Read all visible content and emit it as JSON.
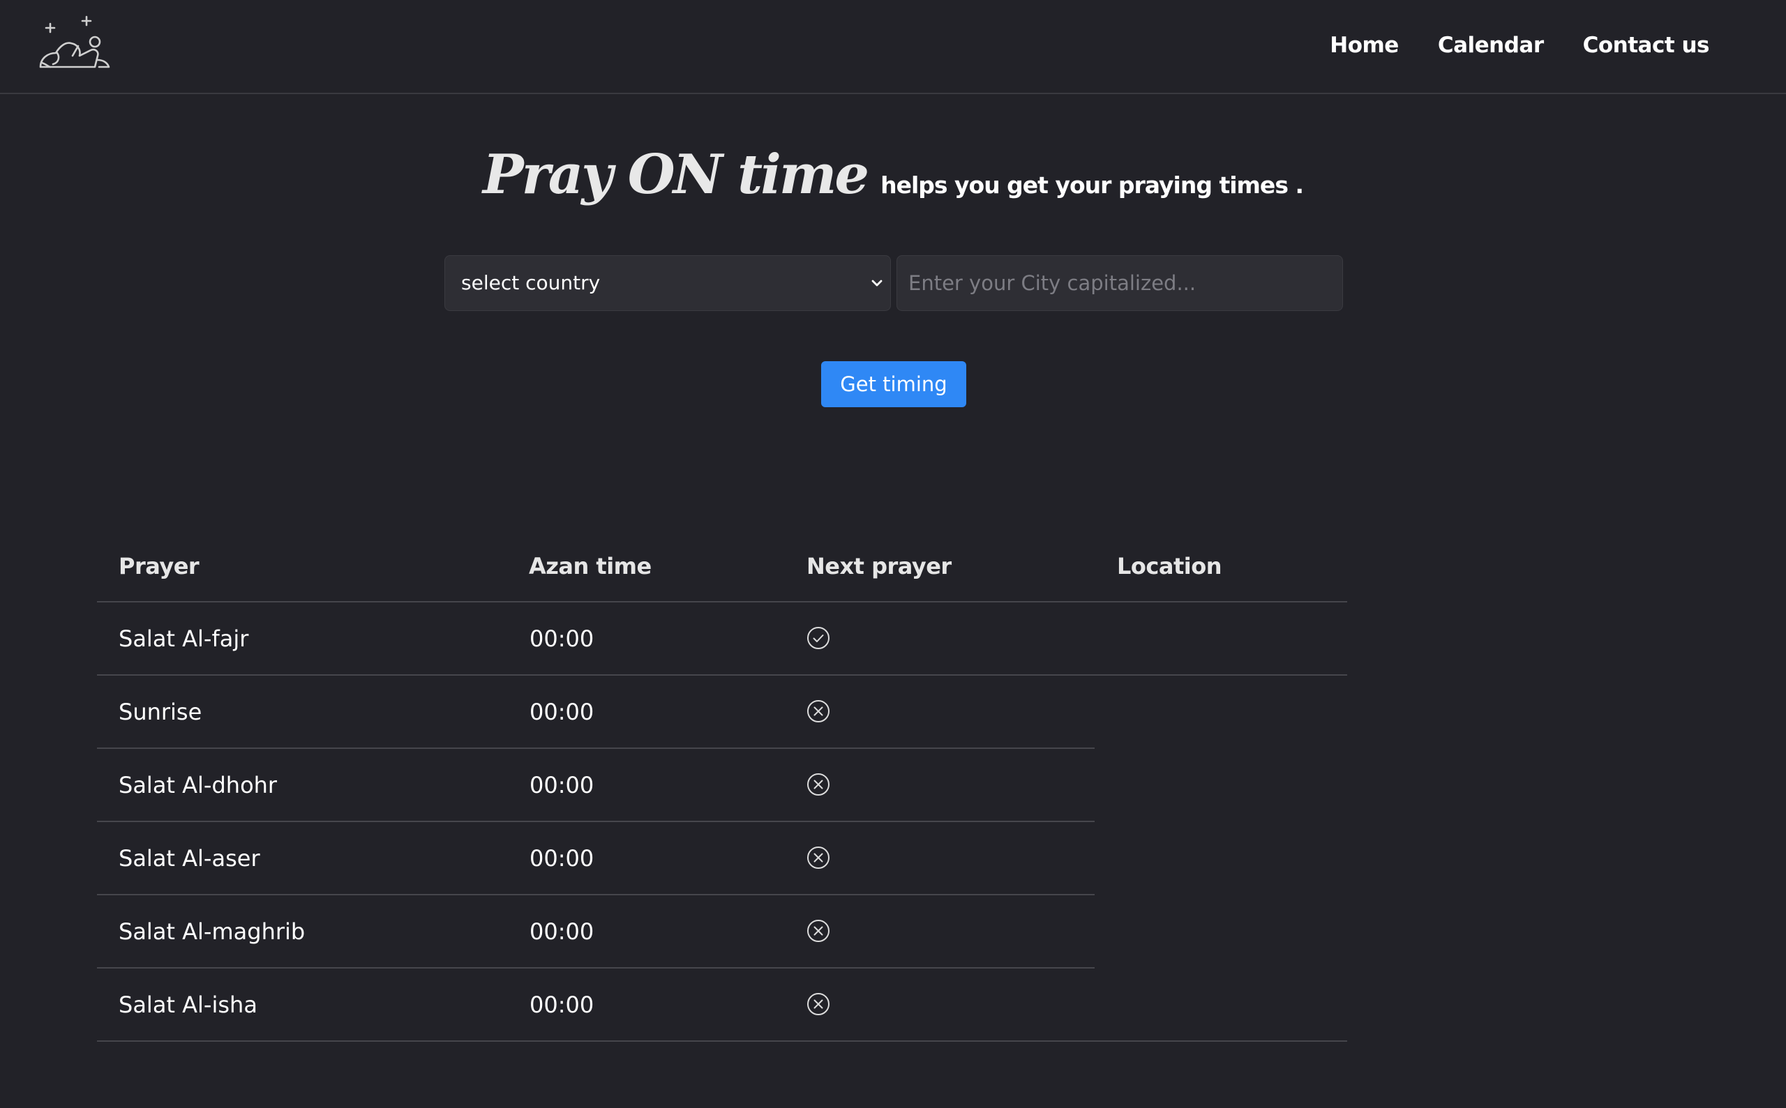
{
  "nav": {
    "logo": "praying-person-logo-icon",
    "links": [
      "Home",
      "Calendar",
      "Contact us"
    ]
  },
  "hero": {
    "brand": "Pray ON time",
    "tagline": "helps you get your praying times ."
  },
  "form": {
    "country_value": "select country",
    "city_placeholder": "Enter your City capitalized...",
    "city_value": "",
    "submit_label": "Get timing"
  },
  "table": {
    "headers": [
      "Prayer",
      "Azan time",
      "Next prayer",
      "Location"
    ],
    "rows": [
      {
        "prayer": "Salat Al-fajr",
        "time": "00:00",
        "next": true,
        "status_icon": "check-circle-icon"
      },
      {
        "prayer": "Sunrise",
        "time": "00:00",
        "next": false,
        "status_icon": "x-circle-icon"
      },
      {
        "prayer": "Salat Al-dhohr",
        "time": "00:00",
        "next": false,
        "status_icon": "x-circle-icon"
      },
      {
        "prayer": "Salat Al-aser",
        "time": "00:00",
        "next": false,
        "status_icon": "x-circle-icon"
      },
      {
        "prayer": "Salat Al-maghrib",
        "time": "00:00",
        "next": false,
        "status_icon": "x-circle-icon"
      },
      {
        "prayer": "Salat Al-isha",
        "time": "00:00",
        "next": false,
        "status_icon": "x-circle-icon"
      }
    ],
    "location": ""
  },
  "colors": {
    "background": "#222228",
    "accent": "#2f88f5",
    "divider": "#46464c",
    "input_bg": "#2e2e34"
  }
}
